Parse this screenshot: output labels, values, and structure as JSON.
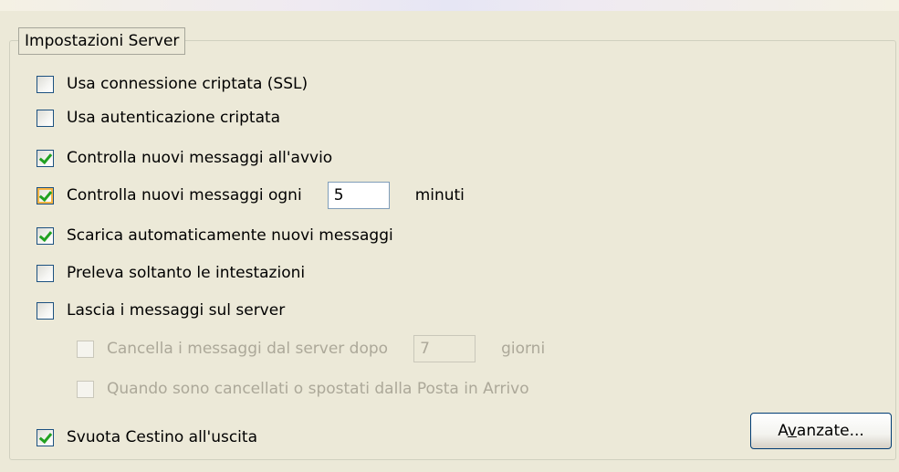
{
  "group": {
    "title": "Impostazioni Server"
  },
  "options": [
    {
      "label": "Usa connessione criptata (SSL)",
      "checked": false
    },
    {
      "label": "Usa autenticazione criptata",
      "checked": false
    },
    {
      "label": "Controlla nuovi messaggi all'avvio",
      "checked": true
    },
    {
      "label": "Controlla nuovi messaggi ogni",
      "checked": true,
      "value": "5",
      "unit": "minuti"
    },
    {
      "label": "Scarica automaticamente nuovi messaggi",
      "checked": true
    },
    {
      "label": "Preleva soltanto le intestazioni",
      "checked": false
    },
    {
      "label": "Lascia i messaggi sul server",
      "checked": false
    },
    {
      "label": "Cancella i messaggi dal server dopo",
      "checked": false,
      "disabled": true,
      "value": "7",
      "unit": "giorni"
    },
    {
      "label": "Quando sono cancellati o spostati dalla Posta in Arrivo",
      "checked": false,
      "disabled": true
    },
    {
      "label": "Svuota Cestino all'uscita",
      "checked": true
    }
  ],
  "advanced_button": {
    "label": "Avanzate...",
    "mnemonic": "v"
  },
  "colors": {
    "background": "#ece9d8",
    "checkbox_border": "#1c5180",
    "checkmark": "#21a121",
    "focus_ring": "#f8b442",
    "disabled_text": "#aca899"
  }
}
